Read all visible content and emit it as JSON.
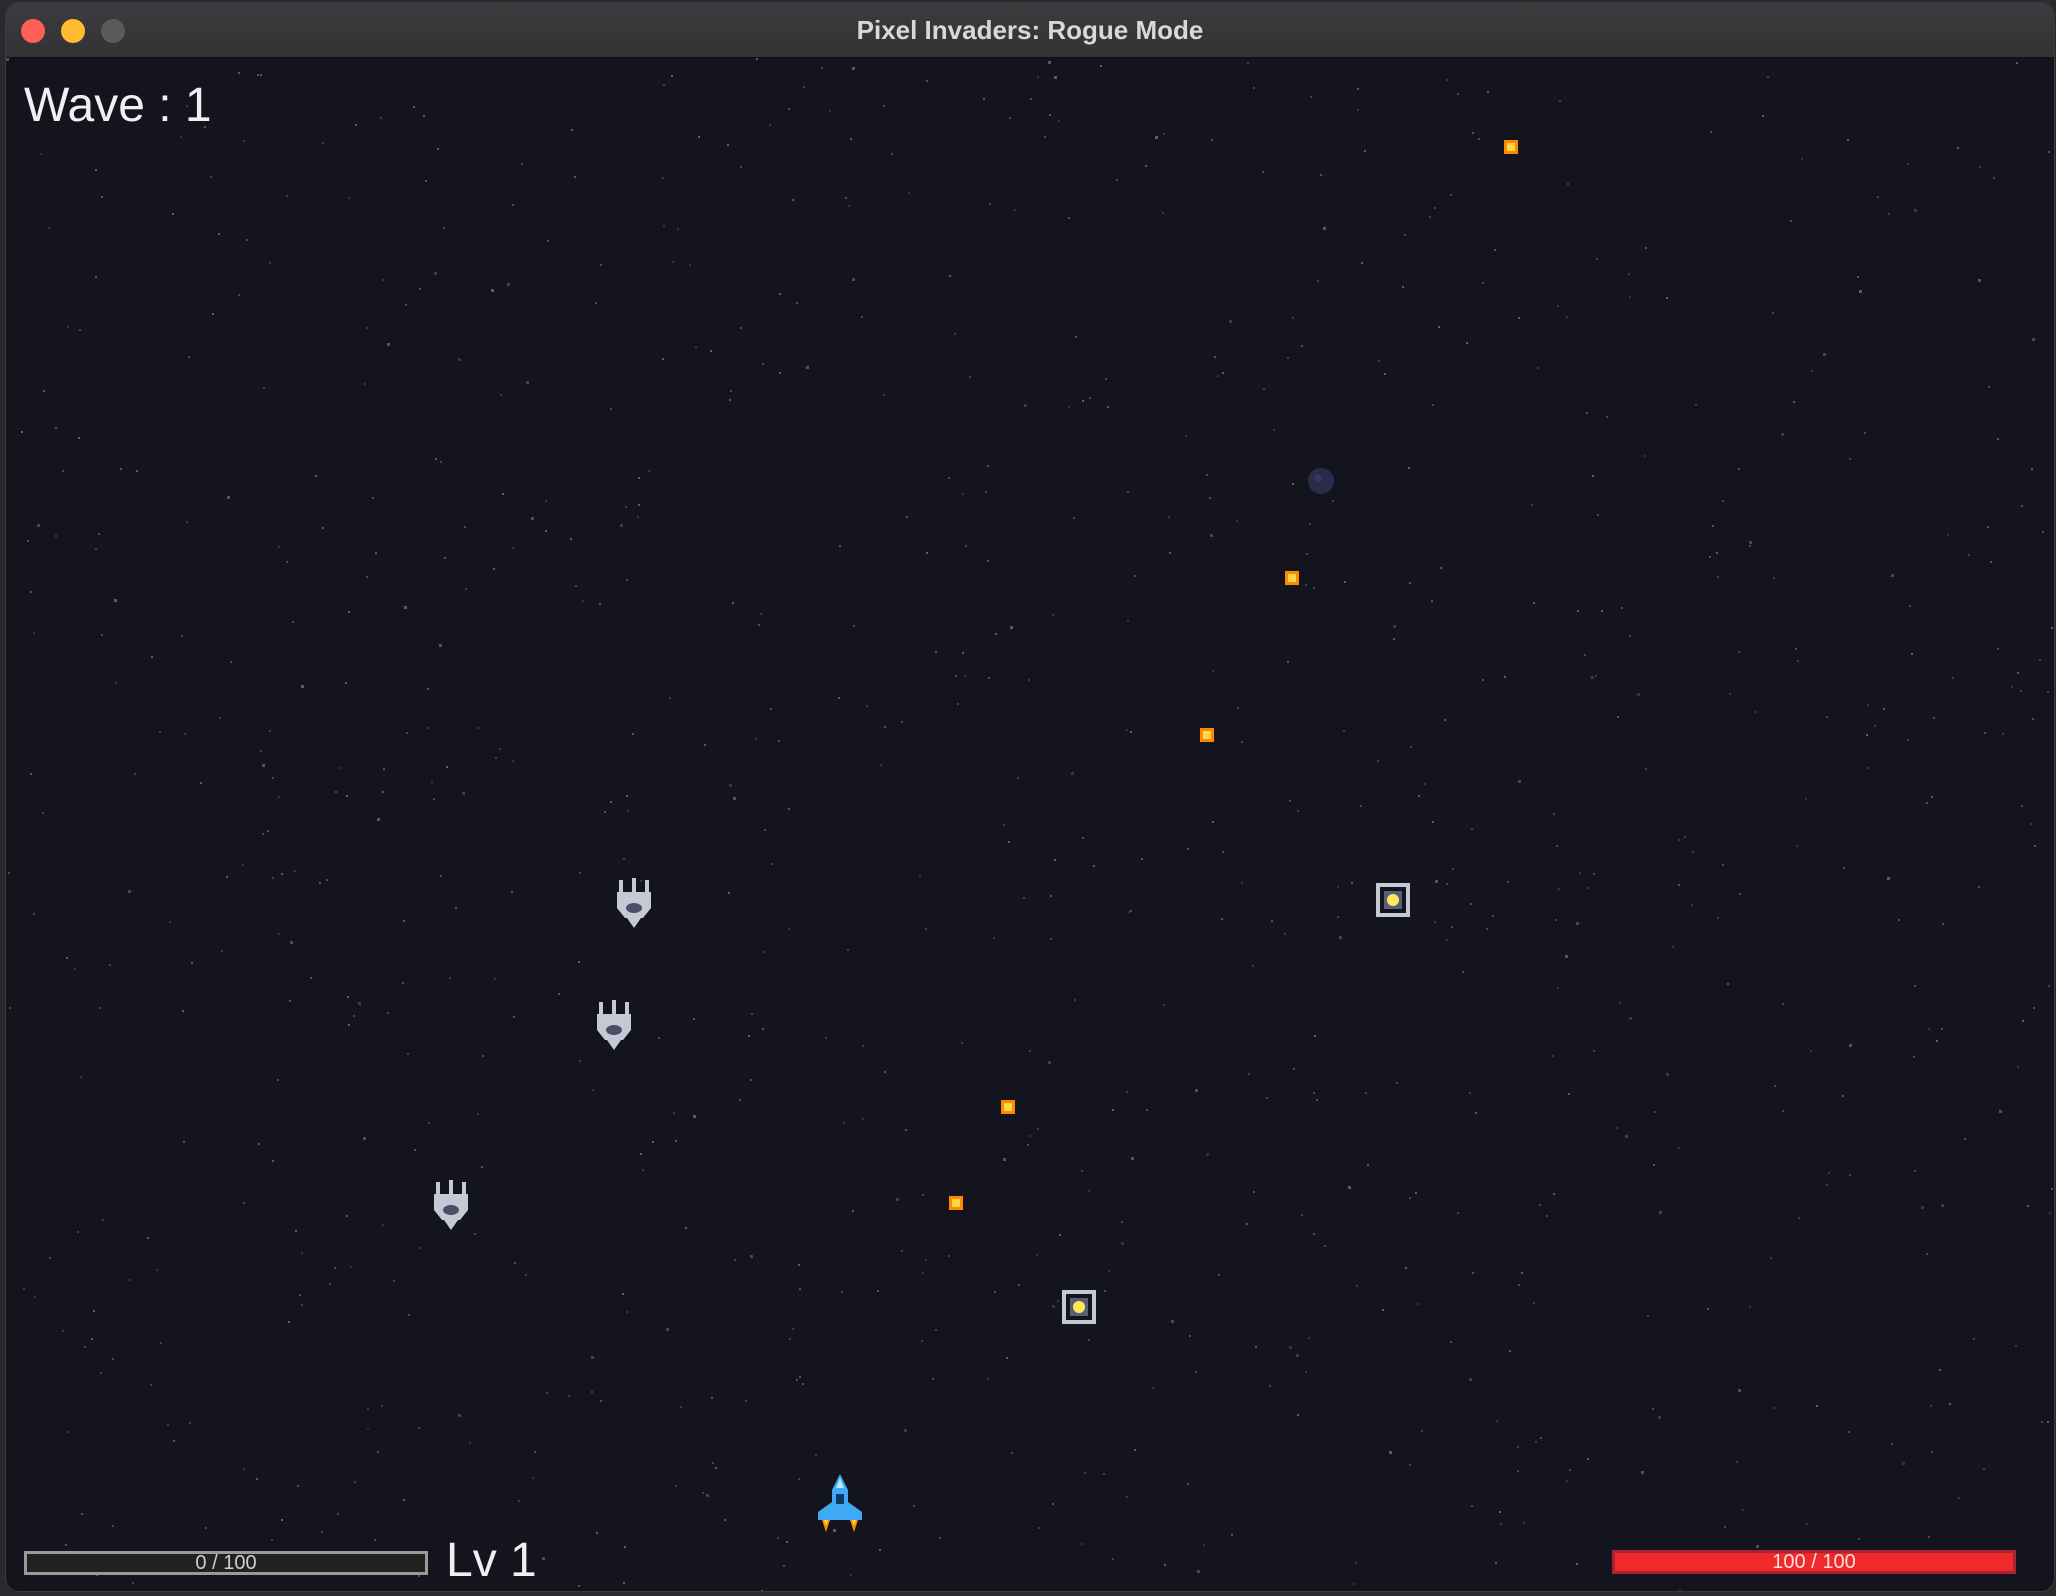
{
  "window": {
    "title": "Pixel Invaders: Rogue Mode"
  },
  "hud": {
    "wave_label": "Wave : 1",
    "xp": {
      "text": "0 / 100",
      "fraction": 0.0
    },
    "level_label": "Lv 1",
    "hp": {
      "text": "100 / 100",
      "fraction": 1.0
    }
  },
  "colors": {
    "background": "#14141f",
    "star": "#6b6b7a",
    "enemy_bullet": "#ffb020",
    "enemy_ship": "#c5c9d6",
    "player_ship": "#3fa9f5",
    "hp_bar": "#ee2a2a"
  }
}
